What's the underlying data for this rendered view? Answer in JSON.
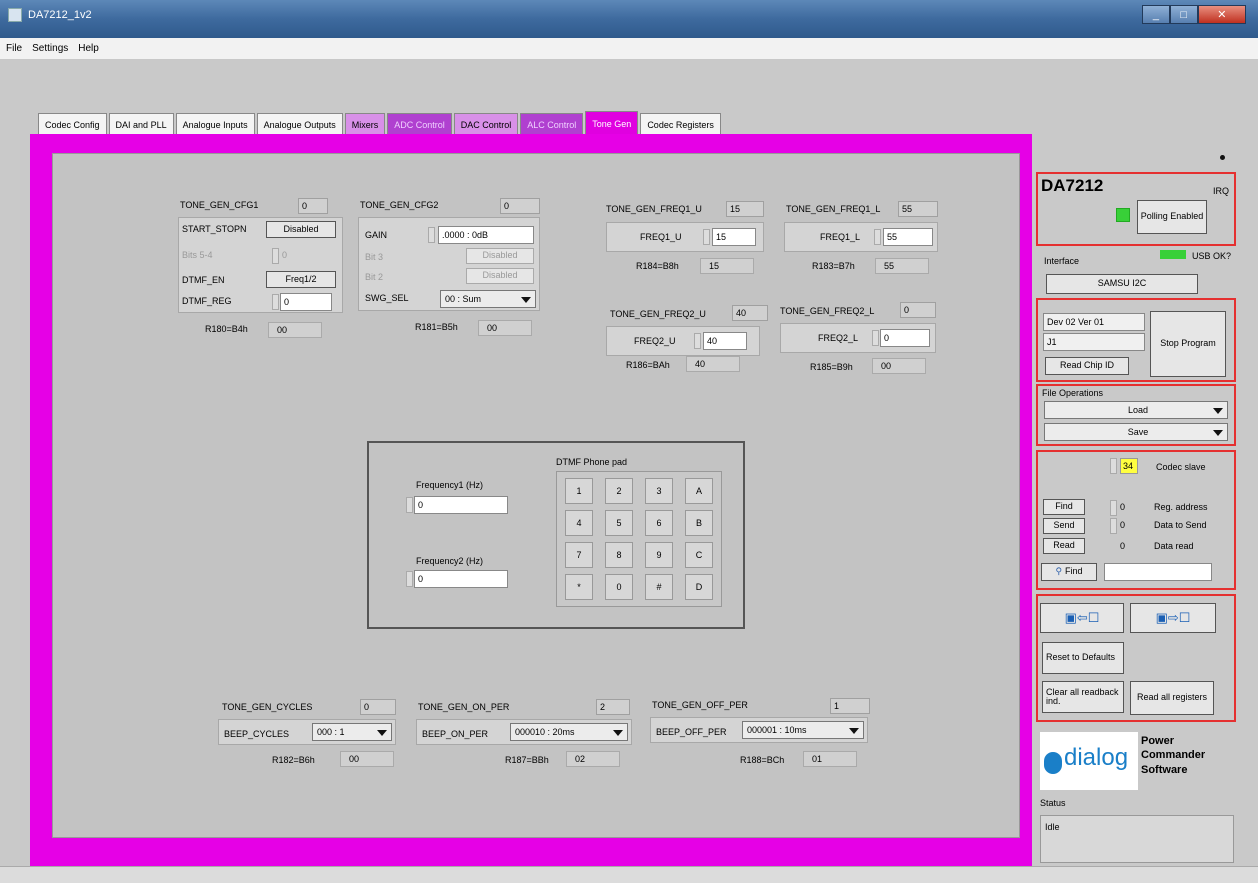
{
  "window": {
    "title": "DA7212_1v2",
    "minimize": "_",
    "maximize": "□",
    "close": "✕"
  },
  "menu": [
    "File",
    "Settings",
    "Help"
  ],
  "tabs": [
    "Codec Config",
    "DAI and PLL",
    "Analogue Inputs",
    "Analogue Outputs",
    "Mixers",
    "ADC Control",
    "DAC Control",
    "ALC Control",
    "Tone Gen",
    "Codec Registers"
  ],
  "cfg1": {
    "title": "TONE_GEN_CFG1",
    "hex": "0",
    "start_stop_label": "START_STOPN",
    "start_stop_btn": "Disabled",
    "bits_label": "Bits 5-4",
    "bits_val": "0",
    "dtmf_en_label": "DTMF_EN",
    "dtmf_en_btn": "Freq1/2",
    "dtmf_reg_label": "DTMF_REG",
    "dtmf_reg_val": "0",
    "reg_label": "R180=B4h",
    "reg_val": "00"
  },
  "cfg2": {
    "title": "TONE_GEN_CFG2",
    "hex": "0",
    "gain_label": "GAIN",
    "gain_val": ".0000 : 0dB",
    "bit3_label": "Bit 3",
    "bit3_btn": "Disabled",
    "bit2_label": "Bit 2",
    "bit2_btn": "Disabled",
    "swg_label": "SWG_SEL",
    "swg_val": "00 : Sum",
    "reg_label": "R181=B5h",
    "reg_val": "00"
  },
  "freq1_u": {
    "title": "TONE_GEN_FREQ1_U",
    "hex": "15",
    "field": "FREQ1_U",
    "val": "15",
    "reg_label": "R184=B8h",
    "reg_val": "15"
  },
  "freq1_l": {
    "title": "TONE_GEN_FREQ1_L",
    "hex": "55",
    "field": "FREQ1_L",
    "val": "55",
    "reg_label": "R183=B7h",
    "reg_val": "55"
  },
  "freq2_u": {
    "title": "TONE_GEN_FREQ2_U",
    "hex": "40",
    "field": "FREQ2_U",
    "val": "40",
    "reg_label": "R186=BAh",
    "reg_val": "40"
  },
  "freq2_l": {
    "title": "TONE_GEN_FREQ2_L",
    "hex": "0",
    "field": "FREQ2_L",
    "val": "0",
    "reg_label": "R185=B9h",
    "reg_val": "00"
  },
  "dtmf": {
    "title": "DTMF Phone pad",
    "freq1_label": "Frequency1 (Hz)",
    "freq1_val": "0",
    "freq2_label": "Frequency2 (Hz)",
    "freq2_val": "0",
    "keys": [
      "1",
      "2",
      "3",
      "A",
      "4",
      "5",
      "6",
      "B",
      "7",
      "8",
      "9",
      "C",
      "*",
      "0",
      "#",
      "D"
    ]
  },
  "cycles": {
    "title": "TONE_GEN_CYCLES",
    "hex": "0",
    "field": "BEEP_CYCLES",
    "val": "000 : 1",
    "reg_label": "R182=B6h",
    "reg_val": "00"
  },
  "on_per": {
    "title": "TONE_GEN_ON_PER",
    "hex": "2",
    "field": "BEEP_ON_PER",
    "val": "000010 : 20ms",
    "reg_label": "R187=BBh",
    "reg_val": "02"
  },
  "off_per": {
    "title": "TONE_GEN_OFF_PER",
    "hex": "1",
    "field": "BEEP_OFF_PER",
    "val": "000001 : 10ms",
    "reg_label": "R188=BCh",
    "reg_val": "01"
  },
  "side": {
    "chip": "DA7212",
    "irq": "IRQ",
    "polling": "Polling Enabled",
    "usb": "USB OK?",
    "interface_label": "Interface",
    "interface_val": "SAMSU I2C",
    "dev": "Dev 02  Ver 01",
    "j": "J1",
    "read_chip": "Read Chip ID",
    "stop": "Stop Program",
    "file_ops": "File Operations",
    "load": "Load",
    "save": "Save",
    "codec_slave_val": "34",
    "codec_slave": "Codec slave",
    "find": "Find",
    "send": "Send",
    "read": "Read",
    "reg_addr_val": "0",
    "reg_addr": "Reg. address",
    "data_send_val": "0",
    "data_send": "Data to Send",
    "data_read_val": "0",
    "data_read": "Data read",
    "find2": "Find",
    "reset": "Reset to Defaults",
    "clear": "Clear all readback ind.",
    "read_all": "Read all registers",
    "logo_text": "dialog",
    "logo_sub": "Power Commander Software",
    "status_label": "Status",
    "status_val": "Idle"
  },
  "colors": {
    "accent": "#e600e6",
    "led": "#38d038",
    "hilite": "#ffff40"
  }
}
